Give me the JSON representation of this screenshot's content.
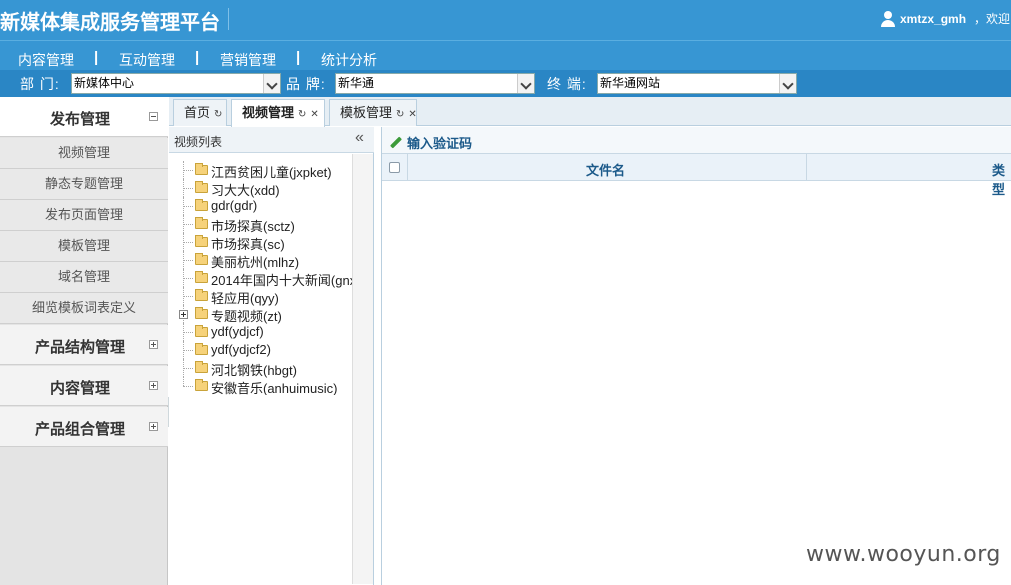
{
  "header": {
    "title": "新媒体集成服务管理平台",
    "username": "xmtzx_gmh",
    "welcome": "，欢迎"
  },
  "nav": {
    "items": [
      "内容管理",
      "互动管理",
      "营销管理",
      "统计分析"
    ],
    "separator": "|"
  },
  "filters": {
    "department_label": "部  门:",
    "department_value": "新媒体中心",
    "brand_label": "品  牌:",
    "brand_value": "新华通",
    "terminal_label": "终  端:",
    "terminal_value": "新华通网站"
  },
  "sidebar": {
    "groups": [
      {
        "label": "发布管理",
        "expanded": true
      },
      {
        "label": "产品结构管理",
        "expanded": false
      },
      {
        "label": "内容管理",
        "expanded": false
      },
      {
        "label": "产品组合管理",
        "expanded": false
      }
    ],
    "items": [
      "视频管理",
      "静态专题管理",
      "发布页面管理",
      "模板管理",
      "域名管理",
      "细览模板词表定义"
    ]
  },
  "tabs": [
    {
      "label": "首页",
      "closable": false
    },
    {
      "label": "视频管理",
      "closable": true,
      "active": true
    },
    {
      "label": "模板管理",
      "closable": true
    }
  ],
  "tree": {
    "title": "视频列表",
    "collapse_glyph": "«",
    "items": [
      {
        "label": "江西贫困儿童(jxpket)",
        "has_children": false
      },
      {
        "label": "习大大(xdd)",
        "has_children": false
      },
      {
        "label": "gdr(gdr)",
        "has_children": false
      },
      {
        "label": "市场探真(sctz)",
        "has_children": false
      },
      {
        "label": "市场探真(sc)",
        "has_children": false
      },
      {
        "label": "美丽杭州(mlhz)",
        "has_children": false
      },
      {
        "label": "2014年国内十大新闻(gnx",
        "has_children": false
      },
      {
        "label": "轻应用(qyy)",
        "has_children": false
      },
      {
        "label": "专题视频(zt)",
        "has_children": true
      },
      {
        "label": "ydf(ydjcf)",
        "has_children": false
      },
      {
        "label": "ydf(ydjcf2)",
        "has_children": false
      },
      {
        "label": "河北钢铁(hbgt)",
        "has_children": false
      },
      {
        "label": "安徽音乐(anhuimusic)",
        "has_children": false
      }
    ]
  },
  "content": {
    "toolbar_button": "输入验证码",
    "columns": [
      "文件名",
      "类型"
    ]
  },
  "watermark": "www.wooyun.org",
  "colors": {
    "header_bg": "#3796d3",
    "filter_bg": "#2a86c5",
    "accent_text": "#1c5a8a"
  }
}
